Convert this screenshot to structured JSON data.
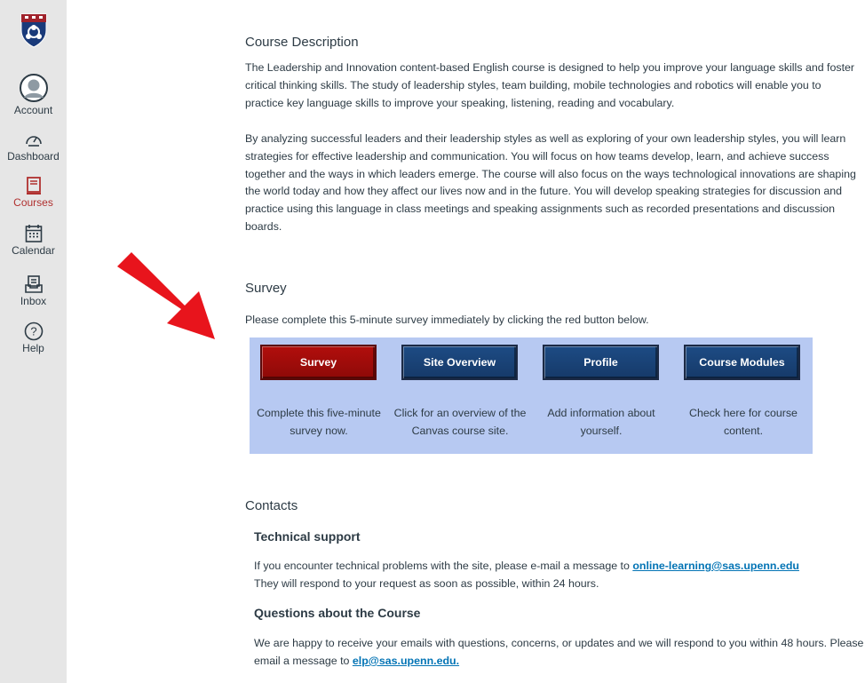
{
  "sidebar": {
    "items": [
      {
        "label": "Account",
        "icon": "account-icon"
      },
      {
        "label": "Dashboard",
        "icon": "dashboard-icon"
      },
      {
        "label": "Courses",
        "icon": "courses-icon",
        "active": true
      },
      {
        "label": "Calendar",
        "icon": "calendar-icon"
      },
      {
        "label": "Inbox",
        "icon": "inbox-icon"
      },
      {
        "label": "Help",
        "icon": "help-icon"
      }
    ]
  },
  "description": {
    "heading": "Course Description",
    "p1": "The Leadership and Innovation content-based English course is designed to help you improve your language skills and foster critical thinking skills.  The study of leadership styles, team building, mobile technologies and robotics will enable you to practice key language skills to improve your speaking, listening, reading and vocabulary.",
    "p2": "By analyzing successful leaders and their leadership styles as well as exploring of your own leadership styles, you will learn strategies for effective leadership and communication. You will focus on how teams develop, learn, and achieve success together and the ways in which leaders emerge.   The course will also focus on the ways technological innovations are shaping the world today and how they affect our lives now and in the future.  You will develop speaking strategies for discussion and practice using this language in class meetings and speaking assignments such as recorded presentations and discussion boards."
  },
  "survey": {
    "heading": "Survey",
    "intro": "Please complete this 5-minute survey immediately by clicking the red button below.",
    "buttons": [
      {
        "label": "Survey",
        "desc": "Complete this five-minute survey now."
      },
      {
        "label": "Site Overview",
        "desc": "Click for an overview of the Canvas course site."
      },
      {
        "label": "Profile",
        "desc": "Add information about yourself."
      },
      {
        "label": "Course Modules",
        "desc": "Check here for course content."
      }
    ]
  },
  "contacts": {
    "heading": "Contacts",
    "tech_heading": "Technical support",
    "tech_text_before": "If you encounter technical problems with the site, please e-mail a message to ",
    "tech_email": "online-learning@sas.upenn.edu",
    "tech_text_after": "They will respond to your request as soon as possible, within 24 hours.",
    "course_heading": "Questions about the Course",
    "course_text": "We are happy to receive your emails with questions, concerns, or updates and we will respond to you within 48 hours.  Please email a message to ",
    "course_email": "elp@sas.upenn.edu."
  },
  "colors": {
    "accent_red": "#b0302f",
    "button_blue": "#1d4b84",
    "survey_red": "#b10e0c",
    "panel": "#b7c9f2",
    "link": "#0374b5"
  }
}
